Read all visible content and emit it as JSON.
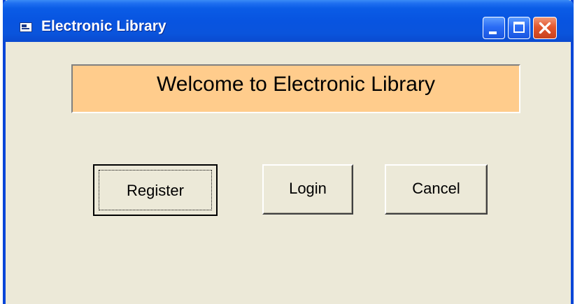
{
  "window": {
    "title": "Electronic Library",
    "icon": "app-window-icon",
    "controls": {
      "minimize": "minimize-icon",
      "maximize": "maximize-icon",
      "close": "close-icon"
    }
  },
  "banner": {
    "text": "Welcome to Electronic Library",
    "background": "#ffcc8c"
  },
  "buttons": {
    "register": "Register",
    "login": "Login",
    "cancel": "Cancel"
  },
  "colors": {
    "titlebar": "#0854e0",
    "form_background": "#ece9d8",
    "close_button": "#e3572e"
  }
}
